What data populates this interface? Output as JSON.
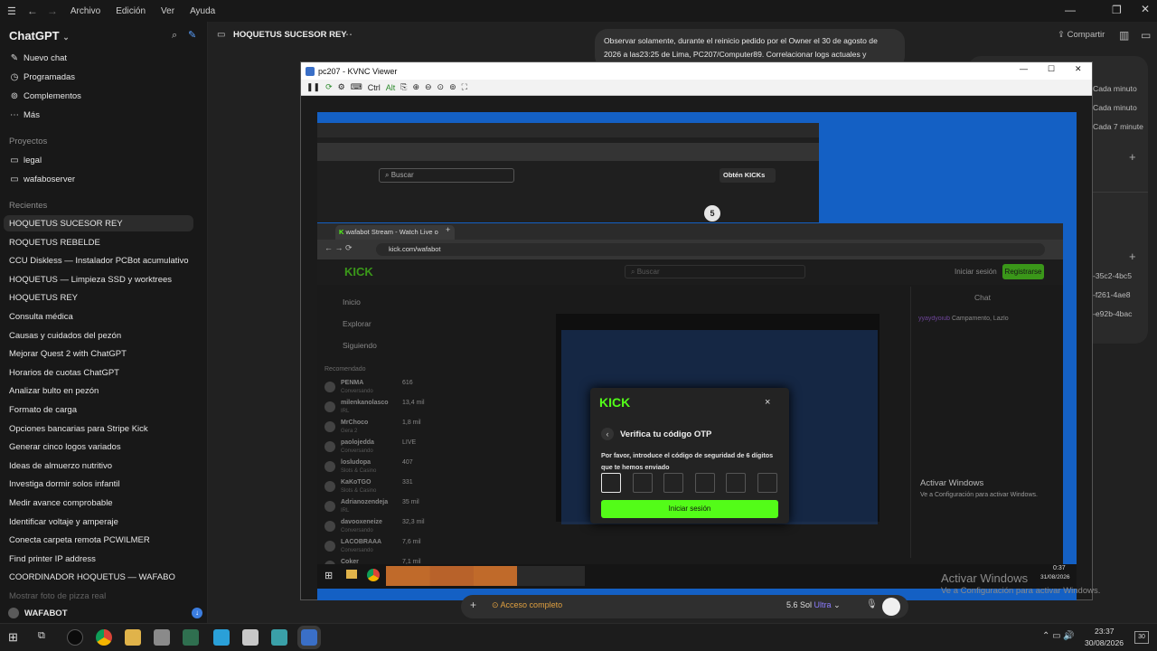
{
  "menubar": {
    "items": [
      "Archivo",
      "Edición",
      "Ver",
      "Ayuda"
    ]
  },
  "sidebar": {
    "app_title": "ChatGPT",
    "primary": [
      {
        "label": "Nuevo chat",
        "icon": "edit-icon"
      },
      {
        "label": "Programadas",
        "icon": "clock-icon"
      },
      {
        "label": "Complementos",
        "icon": "grid-icon"
      },
      {
        "label": "Más",
        "icon": "more-icon"
      }
    ],
    "projects_label": "Proyectos",
    "projects": [
      "legal",
      "wafaboserver"
    ],
    "recent_label": "Recientes",
    "recents": [
      "HOQUETUS SUCESOR REY",
      "ROQUETUS REBELDE",
      "CCU Diskless — Instalador PCBot acumulativo",
      "HOQUETUS — Limpieza SSD y worktrees",
      "HOQUETUS REY",
      "Consulta médica",
      "Causas y cuidados del pezón",
      "Mejorar Quest 2 with ChatGPT",
      "Horarios de cuotas ChatGPT",
      "Analizar bulto en pezón",
      "Formato de carga",
      "Opciones bancarias para Stripe Kick",
      "Generar cinco logos variados",
      "Ideas de almuerzo nutritivo",
      "Investiga dormir solos infantil",
      "Medir avance comprobable",
      "Identificar voltaje y amperaje",
      "Conecta carpeta remota PCWILMER",
      "Find printer IP address",
      "COORDINADOR HOQUETUS — WAFABO",
      "Mostrar foto de pizza real"
    ],
    "user": "WAFABOT"
  },
  "header": {
    "chat_title": "HOQUETUS SUCESOR REY",
    "share": "Compartir"
  },
  "message": {
    "text": "Observar solamente, durante el reinicio pedido por el Owner el 30 de agosto de 2026 a las23:25 de Lima, PC207/Computer89. Correlacionar logs actuales y"
  },
  "right_panel": {
    "lines": [
      "Cada minuto",
      "Cada minuto",
      "Cada 7 minute",
      "-35c2-4bc5",
      "-f261-4ae8",
      "-e92b-4bac"
    ]
  },
  "vnc": {
    "title": "pc207 - KVNC Viewer",
    "toolbar_ctrl": "Ctrl",
    "toolbar_alt": "Alt"
  },
  "remote": {
    "browser_back": {
      "search": "Buscar",
      "kicks": "Obtén KICKs",
      "badge": "5"
    },
    "tab_title": "wafabot Stream - Watch Live o",
    "url": "kick.com/wafabot",
    "kick": {
      "logo": "KICK",
      "search": "Buscar",
      "login": "Iniciar sesión",
      "register": "Registrarse",
      "nav": [
        "Inicio",
        "Explorar",
        "Siguiendo"
      ],
      "recommended": "Recomendado",
      "channels": [
        {
          "name": "PENMA",
          "cat": "Conversando",
          "viewers": "616"
        },
        {
          "name": "milenkanolasco",
          "cat": "IRL",
          "viewers": "13,4 mil"
        },
        {
          "name": "MrChoco",
          "cat": "Gera 2",
          "viewers": "1,8 mil"
        },
        {
          "name": "paolojedda",
          "cat": "Conversando",
          "viewers": "LIVE"
        },
        {
          "name": "losludopa",
          "cat": "Slots & Casino",
          "viewers": "407"
        },
        {
          "name": "KaKoTGO",
          "cat": "Slots & Casino",
          "viewers": "331"
        },
        {
          "name": "Adrianozendeja",
          "cat": "IRL",
          "viewers": "35 mil"
        },
        {
          "name": "davooxeneize",
          "cat": "Conversando",
          "viewers": "32,3 mil"
        },
        {
          "name": "LACOBRAAA",
          "cat": "Conversando",
          "viewers": "7,6 mil"
        },
        {
          "name": "Coker",
          "cat": "",
          "viewers": "7,1 mil"
        }
      ],
      "chat_title": "Chat",
      "chat_msg_user": "yyaydyoiub",
      "chat_msg": "Campamento, Lazlo"
    },
    "otp": {
      "logo": "KICK",
      "title": "Verifica tu código OTP",
      "desc": "Por favor, introduce el código de seguridad de 6 dígitos que te hemos enviado",
      "button": "Iniciar sesión",
      "close": "×"
    },
    "activate": {
      "title": "Activar Windows",
      "sub": "Ve a Configuración para activar Windows."
    },
    "clock": {
      "time": "0:37",
      "date": "31/08/2026"
    }
  },
  "activate_host": {
    "title": "Activar Windows",
    "sub": "Ve a Configuración para activar Windows."
  },
  "composer": {
    "mode": "Acceso completo",
    "model": "5.6 Sol",
    "tier": "Ultra"
  },
  "taskbar": {
    "time": "23:37",
    "date": "30/08/2026",
    "notif": "30"
  }
}
